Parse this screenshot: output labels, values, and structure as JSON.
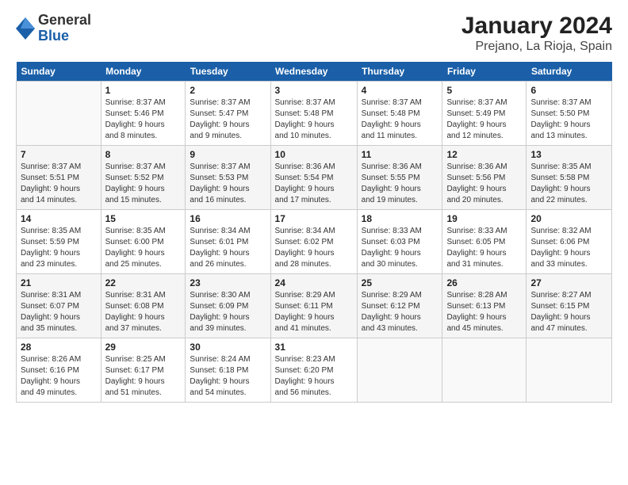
{
  "header": {
    "logo": {
      "general": "General",
      "blue": "Blue"
    },
    "title": "January 2024",
    "subtitle": "Prejano, La Rioja, Spain"
  },
  "calendar": {
    "days_of_week": [
      "Sunday",
      "Monday",
      "Tuesday",
      "Wednesday",
      "Thursday",
      "Friday",
      "Saturday"
    ],
    "weeks": [
      [
        {
          "day": "",
          "info": ""
        },
        {
          "day": "1",
          "info": "Sunrise: 8:37 AM\nSunset: 5:46 PM\nDaylight: 9 hours\nand 8 minutes."
        },
        {
          "day": "2",
          "info": "Sunrise: 8:37 AM\nSunset: 5:47 PM\nDaylight: 9 hours\nand 9 minutes."
        },
        {
          "day": "3",
          "info": "Sunrise: 8:37 AM\nSunset: 5:48 PM\nDaylight: 9 hours\nand 10 minutes."
        },
        {
          "day": "4",
          "info": "Sunrise: 8:37 AM\nSunset: 5:48 PM\nDaylight: 9 hours\nand 11 minutes."
        },
        {
          "day": "5",
          "info": "Sunrise: 8:37 AM\nSunset: 5:49 PM\nDaylight: 9 hours\nand 12 minutes."
        },
        {
          "day": "6",
          "info": "Sunrise: 8:37 AM\nSunset: 5:50 PM\nDaylight: 9 hours\nand 13 minutes."
        }
      ],
      [
        {
          "day": "7",
          "info": "Sunrise: 8:37 AM\nSunset: 5:51 PM\nDaylight: 9 hours\nand 14 minutes."
        },
        {
          "day": "8",
          "info": "Sunrise: 8:37 AM\nSunset: 5:52 PM\nDaylight: 9 hours\nand 15 minutes."
        },
        {
          "day": "9",
          "info": "Sunrise: 8:37 AM\nSunset: 5:53 PM\nDaylight: 9 hours\nand 16 minutes."
        },
        {
          "day": "10",
          "info": "Sunrise: 8:36 AM\nSunset: 5:54 PM\nDaylight: 9 hours\nand 17 minutes."
        },
        {
          "day": "11",
          "info": "Sunrise: 8:36 AM\nSunset: 5:55 PM\nDaylight: 9 hours\nand 19 minutes."
        },
        {
          "day": "12",
          "info": "Sunrise: 8:36 AM\nSunset: 5:56 PM\nDaylight: 9 hours\nand 20 minutes."
        },
        {
          "day": "13",
          "info": "Sunrise: 8:35 AM\nSunset: 5:58 PM\nDaylight: 9 hours\nand 22 minutes."
        }
      ],
      [
        {
          "day": "14",
          "info": "Sunrise: 8:35 AM\nSunset: 5:59 PM\nDaylight: 9 hours\nand 23 minutes."
        },
        {
          "day": "15",
          "info": "Sunrise: 8:35 AM\nSunset: 6:00 PM\nDaylight: 9 hours\nand 25 minutes."
        },
        {
          "day": "16",
          "info": "Sunrise: 8:34 AM\nSunset: 6:01 PM\nDaylight: 9 hours\nand 26 minutes."
        },
        {
          "day": "17",
          "info": "Sunrise: 8:34 AM\nSunset: 6:02 PM\nDaylight: 9 hours\nand 28 minutes."
        },
        {
          "day": "18",
          "info": "Sunrise: 8:33 AM\nSunset: 6:03 PM\nDaylight: 9 hours\nand 30 minutes."
        },
        {
          "day": "19",
          "info": "Sunrise: 8:33 AM\nSunset: 6:05 PM\nDaylight: 9 hours\nand 31 minutes."
        },
        {
          "day": "20",
          "info": "Sunrise: 8:32 AM\nSunset: 6:06 PM\nDaylight: 9 hours\nand 33 minutes."
        }
      ],
      [
        {
          "day": "21",
          "info": "Sunrise: 8:31 AM\nSunset: 6:07 PM\nDaylight: 9 hours\nand 35 minutes."
        },
        {
          "day": "22",
          "info": "Sunrise: 8:31 AM\nSunset: 6:08 PM\nDaylight: 9 hours\nand 37 minutes."
        },
        {
          "day": "23",
          "info": "Sunrise: 8:30 AM\nSunset: 6:09 PM\nDaylight: 9 hours\nand 39 minutes."
        },
        {
          "day": "24",
          "info": "Sunrise: 8:29 AM\nSunset: 6:11 PM\nDaylight: 9 hours\nand 41 minutes."
        },
        {
          "day": "25",
          "info": "Sunrise: 8:29 AM\nSunset: 6:12 PM\nDaylight: 9 hours\nand 43 minutes."
        },
        {
          "day": "26",
          "info": "Sunrise: 8:28 AM\nSunset: 6:13 PM\nDaylight: 9 hours\nand 45 minutes."
        },
        {
          "day": "27",
          "info": "Sunrise: 8:27 AM\nSunset: 6:15 PM\nDaylight: 9 hours\nand 47 minutes."
        }
      ],
      [
        {
          "day": "28",
          "info": "Sunrise: 8:26 AM\nSunset: 6:16 PM\nDaylight: 9 hours\nand 49 minutes."
        },
        {
          "day": "29",
          "info": "Sunrise: 8:25 AM\nSunset: 6:17 PM\nDaylight: 9 hours\nand 51 minutes."
        },
        {
          "day": "30",
          "info": "Sunrise: 8:24 AM\nSunset: 6:18 PM\nDaylight: 9 hours\nand 54 minutes."
        },
        {
          "day": "31",
          "info": "Sunrise: 8:23 AM\nSunset: 6:20 PM\nDaylight: 9 hours\nand 56 minutes."
        },
        {
          "day": "",
          "info": ""
        },
        {
          "day": "",
          "info": ""
        },
        {
          "day": "",
          "info": ""
        }
      ]
    ]
  }
}
